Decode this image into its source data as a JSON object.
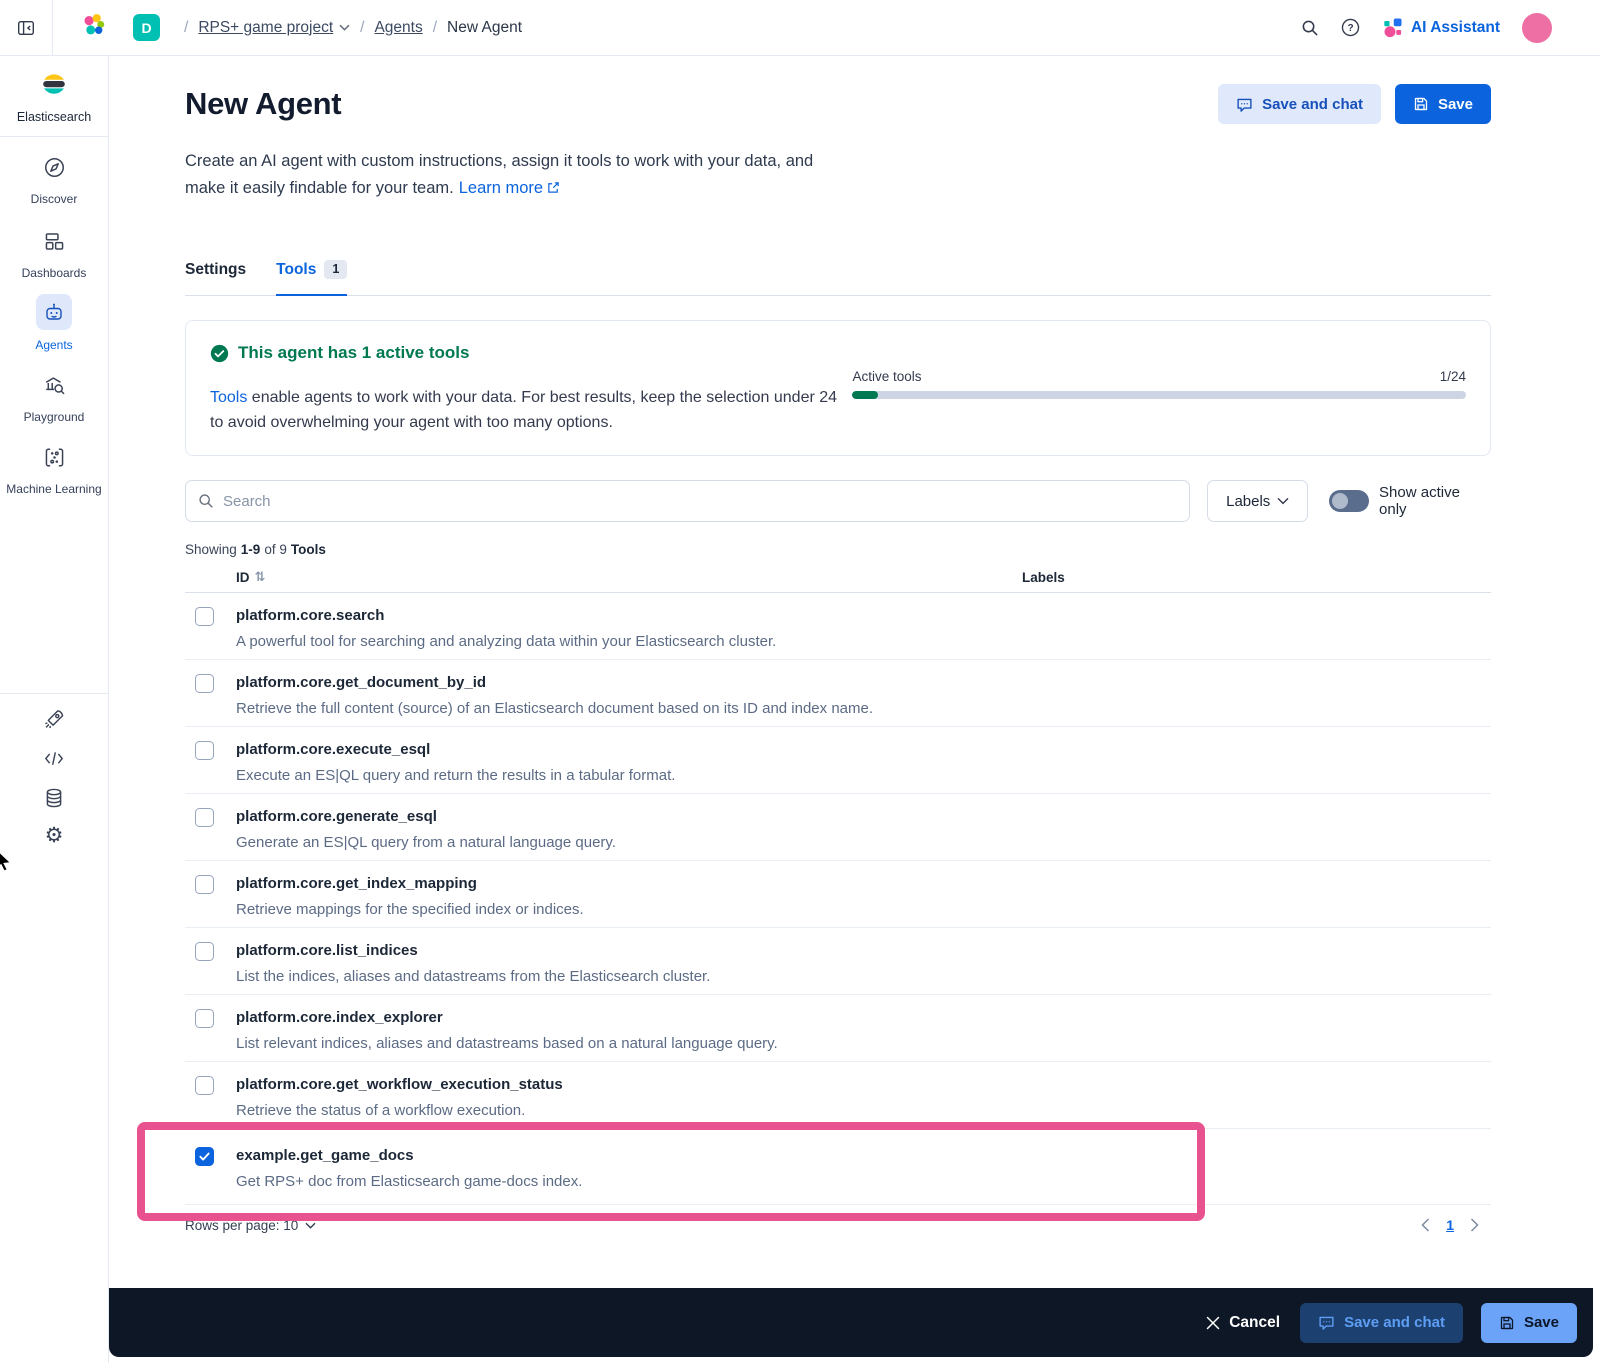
{
  "header": {
    "project_initial": "D",
    "breadcrumb": {
      "project": "RPS+ game project",
      "section": "Agents",
      "page": "New Agent"
    },
    "ai_assistant_label": "AI Assistant"
  },
  "sidebar": {
    "brand": "Elasticsearch",
    "items": [
      {
        "label": "Discover"
      },
      {
        "label": "Dashboards"
      },
      {
        "label": "Agents",
        "active": true
      },
      {
        "label": "Playground"
      },
      {
        "label": "Machine Learning"
      }
    ]
  },
  "page": {
    "title": "New Agent",
    "description_l1": "Create an AI agent with custom instructions, assign it tools to work with your data, and",
    "description_l2": "make it easily findable for your team.",
    "learn_more_label": "Learn more",
    "save_and_chat_label": "Save and chat",
    "save_label": "Save"
  },
  "tabs": {
    "settings_label": "Settings",
    "tools_label": "Tools",
    "tools_count": "1"
  },
  "callout": {
    "title": "This agent has 1 active tools",
    "link_text": "Tools",
    "body_text": " enable agents to work with your data. For best results, keep the selection under 24 to avoid overwhelming your agent with too many options.",
    "progress_label": "Active tools",
    "progress_value": "1/24",
    "progress_percent": 4.2
  },
  "toolbar": {
    "search_placeholder": "Search",
    "labels_label": "Labels",
    "show_active_label": "Show active only"
  },
  "table": {
    "showing": {
      "prefix": "Showing",
      "range": "1-9",
      "mid": "of 9",
      "suffix": "Tools"
    },
    "columns": {
      "id": "ID",
      "labels": "Labels"
    },
    "rows": [
      {
        "id": "platform.core.search",
        "description": "A powerful tool for searching and analyzing data within your Elasticsearch cluster.",
        "checked": false
      },
      {
        "id": "platform.core.get_document_by_id",
        "description": "Retrieve the full content (source) of an Elasticsearch document based on its ID and index name.",
        "checked": false
      },
      {
        "id": "platform.core.execute_esql",
        "description": "Execute an ES|QL query and return the results in a tabular format.",
        "checked": false
      },
      {
        "id": "platform.core.generate_esql",
        "description": "Generate an ES|QL query from a natural language query.",
        "checked": false
      },
      {
        "id": "platform.core.get_index_mapping",
        "description": "Retrieve mappings for the specified index or indices.",
        "checked": false
      },
      {
        "id": "platform.core.list_indices",
        "description": "List the indices, aliases and datastreams from the Elasticsearch cluster.",
        "checked": false
      },
      {
        "id": "platform.core.index_explorer",
        "description": "List relevant indices, aliases and datastreams based on a natural language query.",
        "checked": false
      },
      {
        "id": "platform.core.get_workflow_execution_status",
        "description": "Retrieve the status of a workflow execution.",
        "checked": false
      },
      {
        "id": "example.get_game_docs",
        "description": "Get RPS+ doc from Elasticsearch game-docs index.",
        "checked": true,
        "highlighted": true
      }
    ]
  },
  "pagination": {
    "rows_per_page": "Rows per page: 10",
    "current_page": "1"
  },
  "bottom_bar": {
    "cancel_label": "Cancel",
    "save_and_chat_label": "Save and chat",
    "save_label": "Save"
  },
  "colors": {
    "primary": "#0B64DD",
    "success": "#007852",
    "teal": "#00BFB3",
    "highlight": "#E8538F",
    "bottom_bar": "#0E1726"
  }
}
